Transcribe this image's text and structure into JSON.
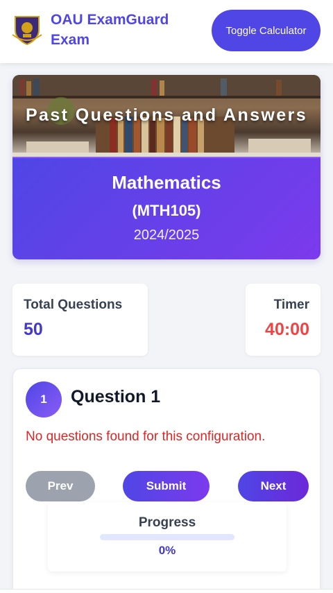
{
  "header": {
    "title": "OAU ExamGuard Exam",
    "logo_icon": "university-crest-icon",
    "toggle_calculator_label": "Toggle Calculator"
  },
  "hero": {
    "banner_title": "Past Questions and Answers",
    "subject": "Mathematics",
    "course_code": "(MTH105)",
    "session": "2024/2025"
  },
  "stats": {
    "total_questions_label": "Total Questions",
    "total_questions_value": "50",
    "timer_label": "Timer",
    "timer_value": "40:00"
  },
  "question": {
    "number": "1",
    "title": "Question 1",
    "message": "No questions found for this configuration."
  },
  "navigation": {
    "prev_label": "Prev",
    "submit_label": "Submit",
    "next_label": "Next"
  },
  "progress": {
    "label": "Progress",
    "percent_text": "0%",
    "fraction": 0
  },
  "colors": {
    "accent": "#4f46e5",
    "accent_secondary": "#7c3aed",
    "timer": "#ef4444",
    "error": "#dc2626"
  }
}
